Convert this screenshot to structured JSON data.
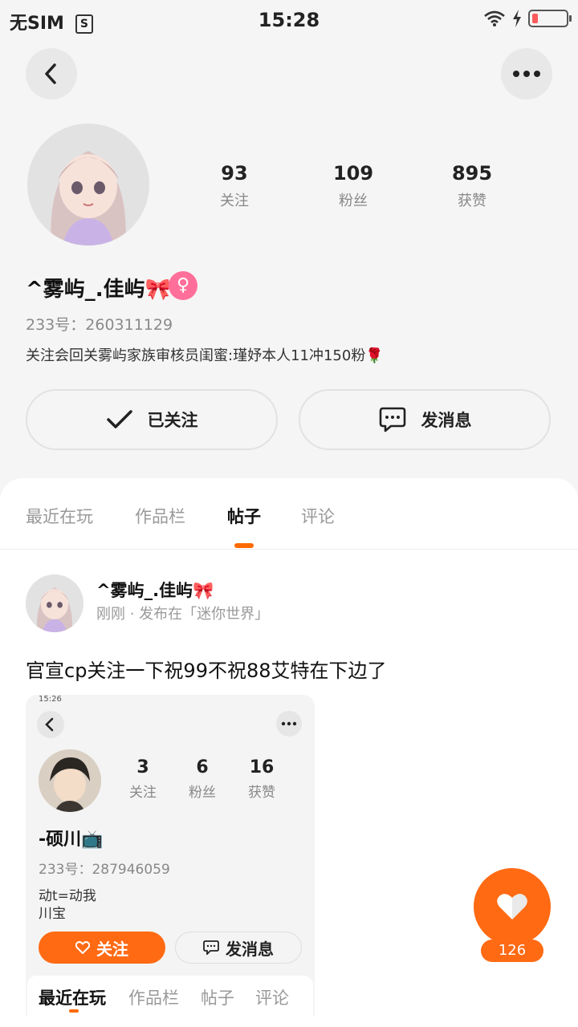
{
  "status_bar": {
    "carrier": "无SIM",
    "sim_icon": "S",
    "time": "15:28",
    "icons": [
      "wifi-icon",
      "charging-icon",
      "battery-icon"
    ],
    "battery_level": 0.18
  },
  "header": {
    "back_icon": "back-arrow-icon",
    "more_icon": "more-dots-icon"
  },
  "profile": {
    "name": "^雾屿_.佳屿🎀",
    "gender_symbol": "♀",
    "uid": "233号：260311129",
    "bio": "关注会回关雾屿家族审核员闺蜜:瑾妤本人11冲150粉🌹",
    "stats": [
      {
        "value": "93",
        "label": "关注"
      },
      {
        "value": "109",
        "label": "粉丝"
      },
      {
        "value": "895",
        "label": "获赞"
      }
    ],
    "follow_button": "已关注",
    "message_button": "发消息"
  },
  "tabs": [
    {
      "label": "最近在玩",
      "active": false
    },
    {
      "label": "作品栏",
      "active": false
    },
    {
      "label": "帖子",
      "active": true
    },
    {
      "label": "评论",
      "active": false
    }
  ],
  "post": {
    "author": "^雾屿_.佳屿🎀",
    "meta": "刚刚 · 发布在「迷你世界」",
    "text": "官宣cp关注一下祝99不祝88艾特在下边了",
    "image": {
      "status_time": "15:26",
      "name": "-硕川📺",
      "uid": "233号：287946059",
      "bio_line1": "动t=动我",
      "bio_line2": "川宝",
      "stats": [
        {
          "value": "3",
          "label": "关注"
        },
        {
          "value": "6",
          "label": "粉丝"
        },
        {
          "value": "16",
          "label": "获赞"
        }
      ],
      "follow_button": "关注",
      "message_button": "发消息",
      "tabs": [
        "最近在玩",
        "作品栏",
        "帖子",
        "评论"
      ]
    }
  },
  "like": {
    "count": "126"
  },
  "colors": {
    "accent": "#ff6a13",
    "gender": "#ff6f9a",
    "tab_indicator": "#ff6a00"
  }
}
